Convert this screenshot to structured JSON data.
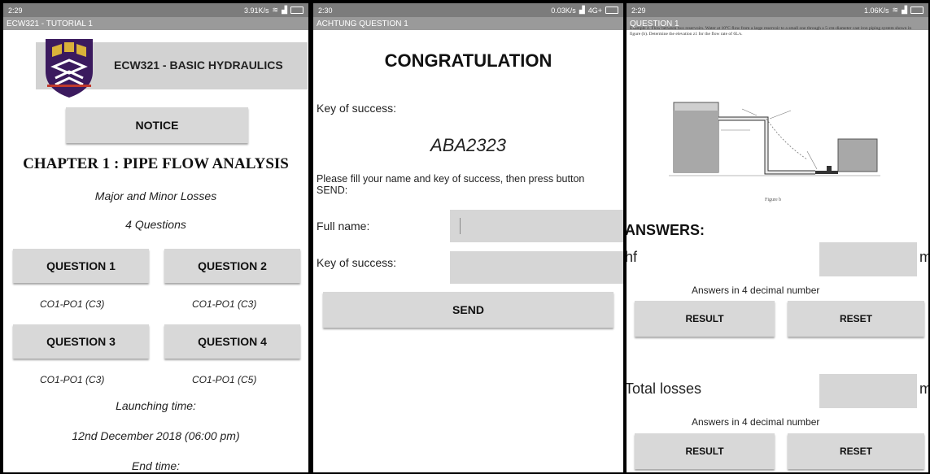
{
  "screens": [
    {
      "status": {
        "time": "2:29",
        "speed": "3.91K/s"
      },
      "title": "ECW321 - TUTORIAL 1",
      "course_title": "ECW321 - BASIC HYDRAULICS",
      "notice_label": "NOTICE",
      "chapter": "CHAPTER 1 : PIPE FLOW ANALYSIS",
      "subtitle": "Major and Minor Losses",
      "questions_count": "4 Questions",
      "questions": [
        {
          "label": "QUESTION 1",
          "code": "CO1-PO1 (C3)"
        },
        {
          "label": "QUESTION 2",
          "code": "CO1-PO1 (C3)"
        },
        {
          "label": "QUESTION 3",
          "code": "CO1-PO1 (C3)"
        },
        {
          "label": "QUESTION 4",
          "code": "CO1-PO1 (C5)"
        }
      ],
      "launch_label": "Launching time:",
      "launch_value": "12nd December 2018 (06:00 pm)",
      "end_label": "End time:"
    },
    {
      "status": {
        "time": "2:30",
        "speed": "0.03K/s",
        "network": "4G+"
      },
      "title": "ACHTUNG QUESTION 1",
      "heading": "CONGRATULATION",
      "key_label": "Key of success:",
      "key_value": "ABA2323",
      "instruction": "Please fill your name and key of success, then press button SEND:",
      "full_name_label": "Full name:",
      "full_name_value": "",
      "key_field_label": "Key of success:",
      "key_field_value": "",
      "send_label": "SEND"
    },
    {
      "status": {
        "time": "2:29",
        "speed": "1.06K/s"
      },
      "title": "QUESTION 1",
      "example_text": "Example 4. Flow between two reservoirs. Water at 10°C flow from a large reservoir to a small one through a 5-cm-diameter cast iron piping system shown in figure (b). Determine the elevation z1 for the flow rate of 6L/s.",
      "figure_caption": "Figure b",
      "answers_label": "ANSWERS:",
      "blocks": [
        {
          "label": "hf",
          "value": "",
          "unit": "m",
          "hint": "Answers in 4 decimal number",
          "result": "RESULT",
          "reset": "RESET"
        },
        {
          "label": "Total losses",
          "value": "",
          "unit": "m",
          "hint": "Answers in 4 decimal number",
          "result": "RESULT",
          "reset": "RESET"
        }
      ]
    }
  ]
}
